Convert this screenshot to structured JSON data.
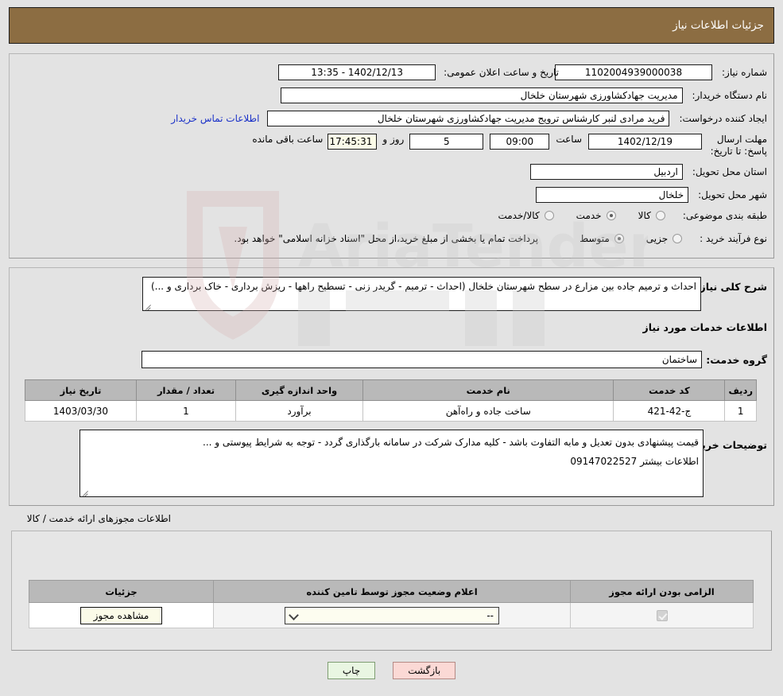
{
  "header": {
    "title": "جزئیات اطلاعات نیاز"
  },
  "need_info": {
    "need_number_label": "شماره نیاز:",
    "need_number_value": "1102004939000038",
    "announce_datetime_label": "تاریخ و ساعت اعلان عمومی:",
    "announce_datetime_value": "1402/12/13 - 13:35",
    "buyer_org_label": "نام دستگاه خریدار:",
    "buyer_org_value": "مدیریت جهادکشاورزی شهرستان خلخال",
    "requester_label": "ایجاد کننده درخواست:",
    "requester_value": "فرید مرادی لنبر کارشناس ترویج مدیریت جهادکشاورزی شهرستان خلخال",
    "buyer_contact_link": "اطلاعات تماس خریدار",
    "deadline_label": "مهلت ارسال پاسخ: تا تاریخ:",
    "deadline_date": "1402/12/19",
    "deadline_time_label": "ساعت",
    "deadline_time": "09:00",
    "remaining_days": "5",
    "days_and_label": "روز و",
    "remaining_clock": "17:45:31",
    "remaining_suffix_label": "ساعت باقی مانده",
    "province_label": "استان محل تحویل:",
    "province_value": "اردبیل",
    "city_label": "شهر محل تحویل:",
    "city_value": "خلخال",
    "category_label": "طبقه بندی موضوعی:",
    "category_options": [
      {
        "label": "کالا",
        "selected": false
      },
      {
        "label": "خدمت",
        "selected": true
      },
      {
        "label": "کالا/خدمت",
        "selected": false
      }
    ],
    "process_label": "نوع فرآیند خرید :",
    "process_options": [
      {
        "label": "جزیی",
        "selected": false
      },
      {
        "label": "متوسط",
        "selected": true
      }
    ],
    "process_note": "پرداخت تمام یا بخشی از مبلغ خرید،از محل \"اسناد خزانه اسلامی\" خواهد بود."
  },
  "description": {
    "label": "شرح کلی نیاز:",
    "value": "احداث و ترمیم جاده بین مزارع در سطح شهرستان خلخال (احداث - ترمیم - گریدر زنی - تسطیح راهها - ریزش برداری - خاک برداری و ...)"
  },
  "services_section": {
    "title": "اطلاعات خدمات مورد نیاز",
    "group_label": "گروه خدمت:",
    "group_value": "ساختمان",
    "columns": [
      "ردیف",
      "کد خدمت",
      "نام خدمت",
      "واحد اندازه گیری",
      "تعداد / مقدار",
      "تاریخ نیاز"
    ],
    "rows": [
      {
        "index": "1",
        "code": "ج-42-421",
        "name": "ساخت جاده و راه‌آهن",
        "unit": "برآورد",
        "qty": "1",
        "date": "1403/03/30"
      }
    ]
  },
  "buyer_notes": {
    "label": "توضیحات خریدار:",
    "line1": "قیمت پیشنهادی بدون تعدیل و مابه التفاوت باشد - کلیه مدارک شرکت در سامانه بارگذاری گردد - توجه به شرایط پیوستی و ...",
    "line2": "اطلاعات بیشتر 09147022527"
  },
  "permits": {
    "section_title": "اطلاعات مجوزهای ارائه خدمت / کالا",
    "columns": [
      "الزامی بودن ارائه مجوز",
      "اعلام وضعیت مجوز توسط تامین کننده",
      "جزئیات"
    ],
    "rows": [
      {
        "required_checked": true,
        "status_value": "--",
        "details_button": "مشاهده مجوز"
      }
    ]
  },
  "footer": {
    "print_label": "چاپ",
    "back_label": "بازگشت"
  },
  "watermark": {
    "text": "AriaTender.net"
  },
  "colors": {
    "header_brown": "#8c6d42",
    "link_blue": "#1a31c8",
    "print_green": "#e9f6e2",
    "back_pink": "#fbd9d5",
    "cream": "#fbfbe8",
    "table_header_gray": "#b9b9b9",
    "page_bg": "#e3e3e3"
  }
}
